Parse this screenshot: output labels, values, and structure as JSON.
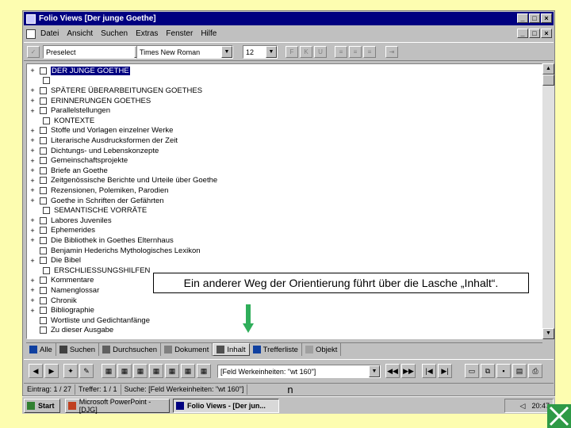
{
  "window": {
    "title": "Folio Views   [Der junge Goethe]",
    "caption_buttons": [
      "_",
      "□",
      "×"
    ]
  },
  "menu": [
    "Datei",
    "Ansicht",
    "Suchen",
    "Extras",
    "Fenster",
    "Hilfe"
  ],
  "toolbar": {
    "style_combo": "Preselect",
    "font_combo": "Times New Roman",
    "size_combo": "12",
    "format_buttons": [
      "F",
      "K",
      "U"
    ]
  },
  "tree": [
    {
      "label": "DER JUNGE GOETHE",
      "level": 0,
      "expander": "+",
      "selected": true
    },
    {
      "label": "",
      "level": 1,
      "expander": "",
      "selected": false
    },
    {
      "label": "SPÄTERE ÜBERARBEITUNGEN GOETHES",
      "level": 0,
      "expander": "+",
      "selected": false
    },
    {
      "label": "ERINNERUNGEN GOETHES",
      "level": 0,
      "expander": "+",
      "selected": false
    },
    {
      "label": "Parallelstellungen",
      "level": 0,
      "expander": "+",
      "selected": false
    },
    {
      "label": "KONTEXTE",
      "level": 1,
      "expander": "",
      "selected": false
    },
    {
      "label": "Stoffe und Vorlagen einzelner Werke",
      "level": 0,
      "expander": "+",
      "selected": false
    },
    {
      "label": "Literarische Ausdrucksformen der Zeit",
      "level": 0,
      "expander": "+",
      "selected": false
    },
    {
      "label": "Dichtungs- und Lebenskonzepte",
      "level": 0,
      "expander": "+",
      "selected": false
    },
    {
      "label": "Gemeinschaftsprojekte",
      "level": 0,
      "expander": "+",
      "selected": false
    },
    {
      "label": "Briefe an Goethe",
      "level": 0,
      "expander": "+",
      "selected": false
    },
    {
      "label": "Zeitgenössische Berichte und Urteile über Goethe",
      "level": 0,
      "expander": "+",
      "selected": false
    },
    {
      "label": "Rezensionen, Polemiken, Parodien",
      "level": 0,
      "expander": "+",
      "selected": false
    },
    {
      "label": "Goethe in Schriften der Gefährten",
      "level": 0,
      "expander": "+",
      "selected": false
    },
    {
      "label": "SEMANTISCHE VORRÄTE",
      "level": 1,
      "expander": "",
      "selected": false
    },
    {
      "label": "Labores Juveniles",
      "level": 0,
      "expander": "+",
      "selected": false
    },
    {
      "label": "Ephemerides",
      "level": 0,
      "expander": "+",
      "selected": false
    },
    {
      "label": "Die Bibliothek in Goethes Elternhaus",
      "level": 0,
      "expander": "+",
      "selected": false
    },
    {
      "label": "Benjamin Hederichs Mythologisches Lexikon",
      "level": 0,
      "expander": "",
      "selected": false
    },
    {
      "label": "Die Bibel",
      "level": 0,
      "expander": "+",
      "selected": false
    },
    {
      "label": "ERSCHLIESSUNGSHILFEN",
      "level": 1,
      "expander": "",
      "selected": false
    },
    {
      "label": "Kommentare",
      "level": 0,
      "expander": "+",
      "selected": false
    },
    {
      "label": "Namenglossar",
      "level": 0,
      "expander": "+",
      "selected": false
    },
    {
      "label": "Chronik",
      "level": 0,
      "expander": "+",
      "selected": false
    },
    {
      "label": "Bibliographie",
      "level": 0,
      "expander": "+",
      "selected": false
    },
    {
      "label": "Wortliste und Gedichtanfänge",
      "level": 0,
      "expander": "",
      "selected": false
    },
    {
      "label": "Zu dieser Ausgabe",
      "level": 0,
      "expander": "",
      "selected": false
    }
  ],
  "callout": "Ein anderer Weg der Orientierung führt über die Lasche „Inhalt“.",
  "tabs": [
    {
      "label": "Alle",
      "icon": "globe-icon",
      "active": false
    },
    {
      "label": "Suchen",
      "icon": "binoculars-icon",
      "active": false
    },
    {
      "label": "Durchsuchen",
      "icon": "book-icon",
      "active": false
    },
    {
      "label": "Dokument",
      "icon": "document-icon",
      "active": false
    },
    {
      "label": "Inhalt",
      "icon": "contents-icon",
      "active": true
    },
    {
      "label": "Trefferliste",
      "icon": "list-icon",
      "active": false
    },
    {
      "label": "Objekt",
      "icon": "object-icon",
      "active": false
    }
  ],
  "navbar": {
    "query_combo": "[Feld Werkeinheiten: \"wt 160\"]"
  },
  "status": {
    "entry": "Eintrag: 1 / 27",
    "hits": "Treffer: 1 / 1",
    "search": "Suche: [Feld Werkeinheiten: \"wt 160\"]",
    "marker": "n"
  },
  "taskbar": {
    "start": "Start",
    "items": [
      "Microsoft PowerPoint - [DJG]",
      "Folio Views - [Der jun..."
    ],
    "clock": "20:47"
  },
  "colors": {
    "background": "#fdfdb0",
    "titlebar": "#000080",
    "callout_arrow": "#2fae5a",
    "logo": "#2e9a46"
  }
}
